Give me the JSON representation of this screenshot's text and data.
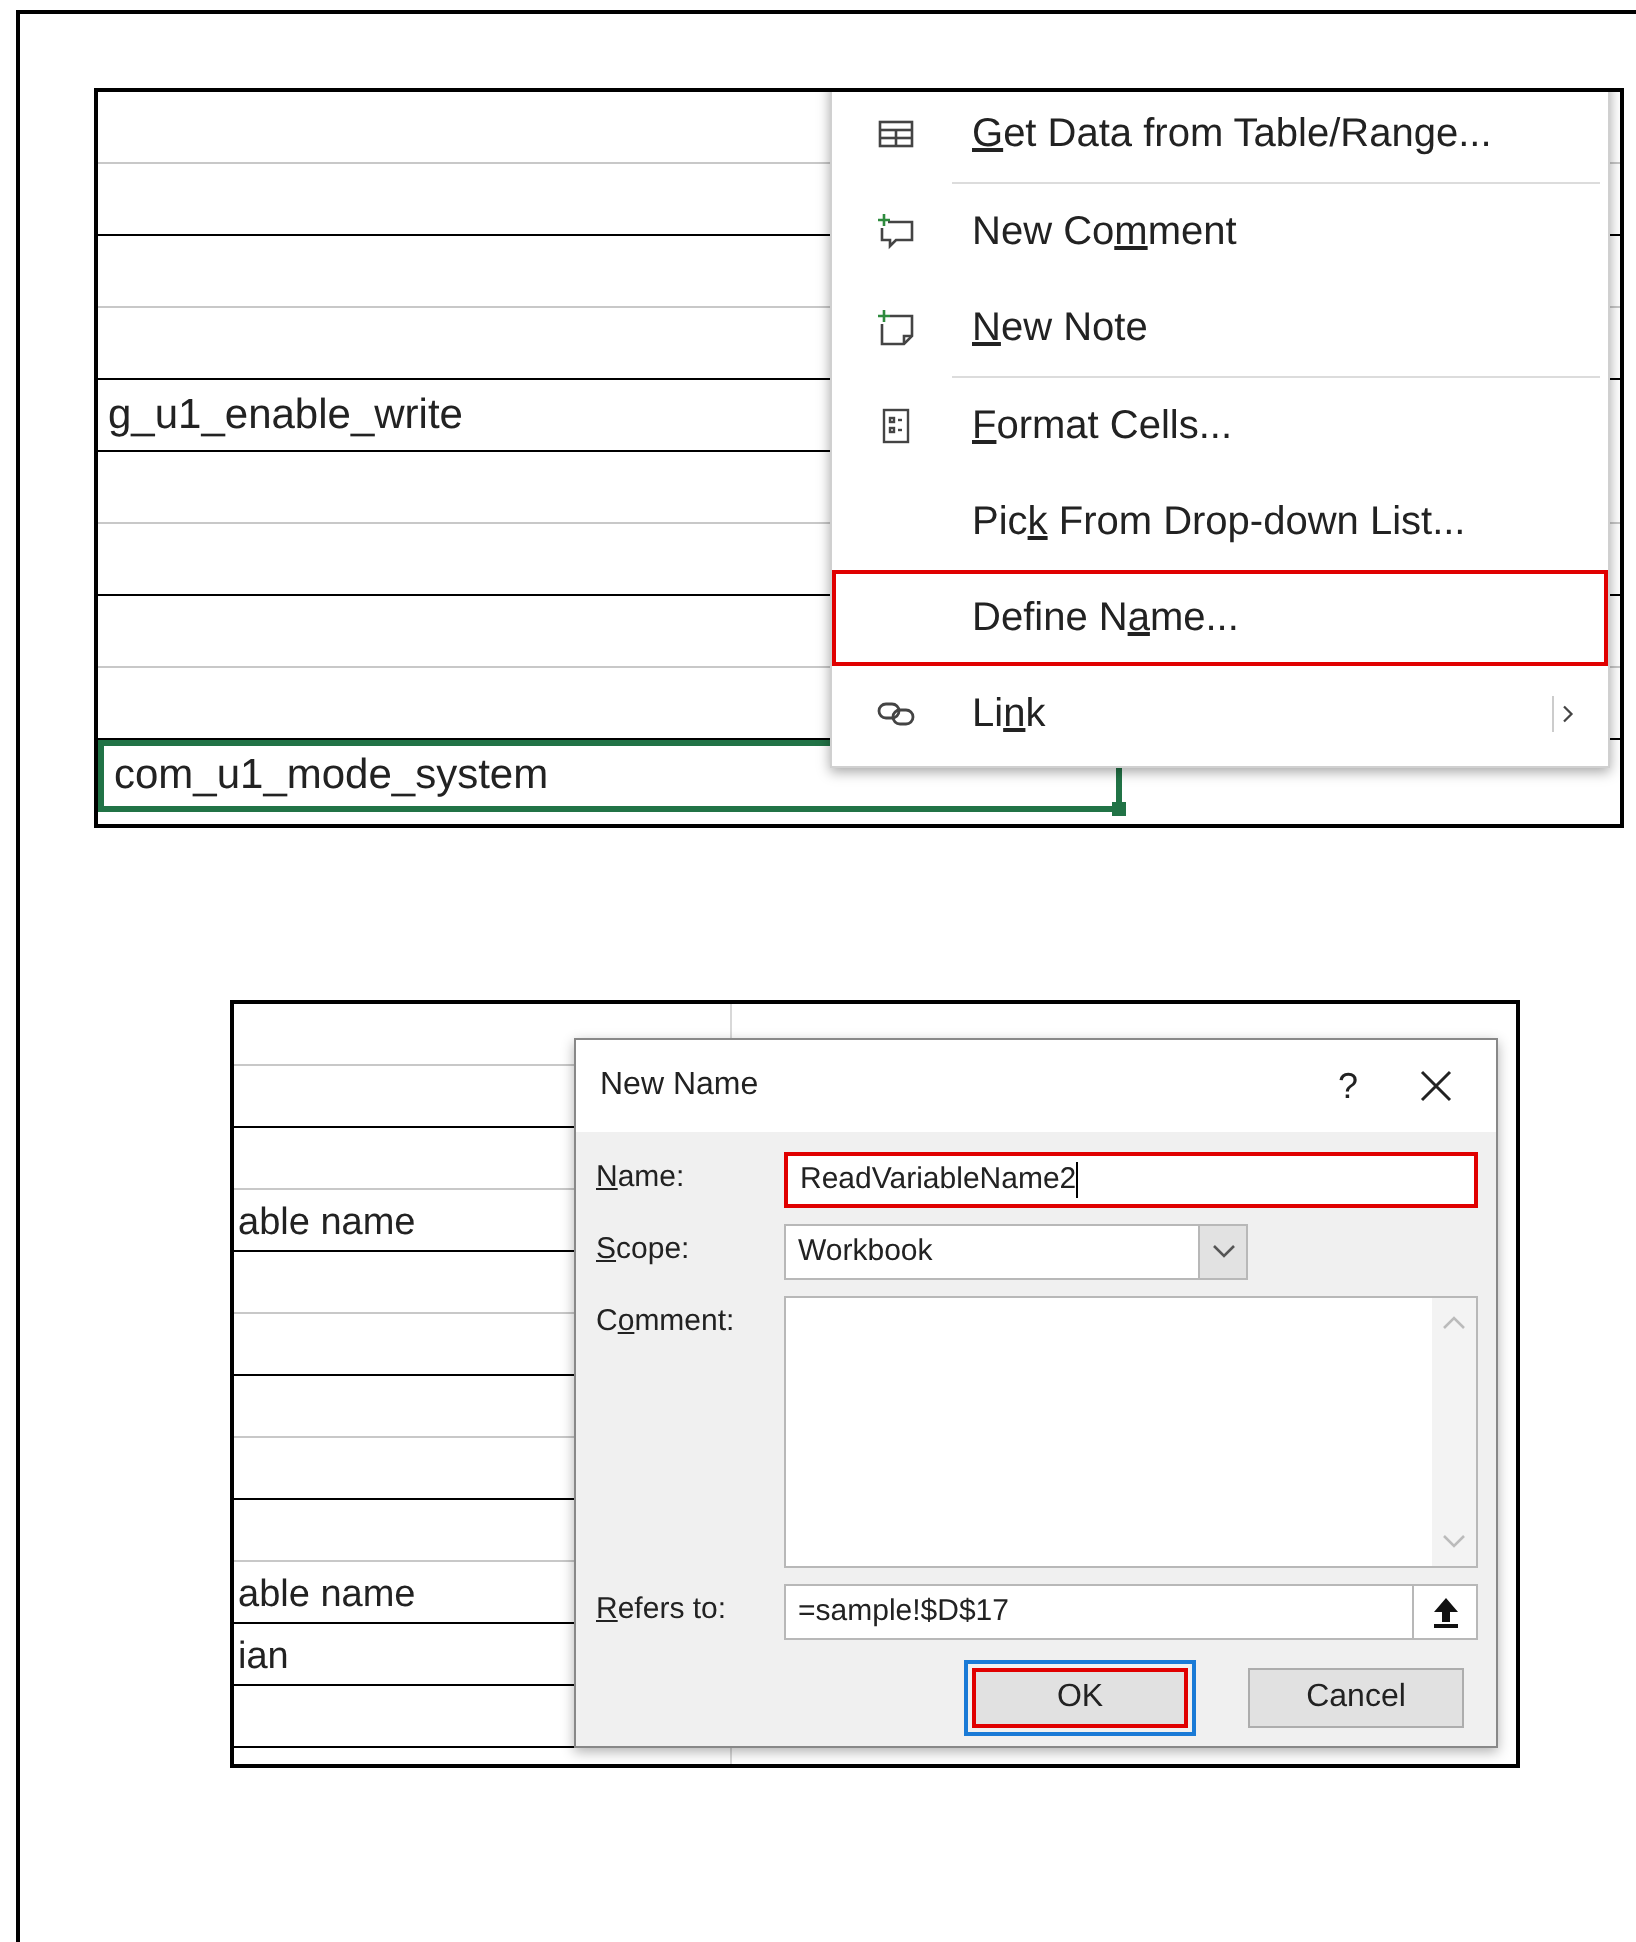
{
  "top_screenshot": {
    "sheet_rows": [
      {
        "column_1": "g_u1_enable_write",
        "selected": false
      },
      {
        "column_1": "com_u1_mode_system",
        "selected": true
      }
    ],
    "context_menu": {
      "items": [
        {
          "kind": "table",
          "label": {
            "key": "G",
            "after": "et Data from Table/Range..."
          },
          "highlighted": false
        },
        {
          "kind": "comment",
          "label": {
            "before": "New Co",
            "key": "m",
            "after": "ment"
          },
          "highlighted": false
        },
        {
          "kind": "note",
          "label": {
            "key": "N",
            "after": "ew Note"
          },
          "highlighted": false
        },
        {
          "kind": "format",
          "label": {
            "key": "F",
            "after": "ormat Cells..."
          },
          "highlighted": false
        },
        {
          "kind": "plain",
          "label": {
            "before": "Pic",
            "key": "k",
            "after": " From Drop-down List..."
          },
          "highlighted": false
        },
        {
          "kind": "plain",
          "label": {
            "before": "Define N",
            "key": "a",
            "after": "me..."
          },
          "highlighted": true
        },
        {
          "kind": "link",
          "label": {
            "before": "Li",
            "key": "n",
            "after": "k"
          },
          "highlighted": false
        }
      ]
    }
  },
  "bottom_screenshot": {
    "sheet_rows": [
      {
        "column_1": "able name"
      },
      {
        "column_1": "able name"
      },
      {
        "column_1": "ian"
      }
    ],
    "dialog": {
      "title": "New Name",
      "help": "?",
      "fields": [
        {
          "kind": "text",
          "label": {
            "key": "N",
            "after": "ame:"
          },
          "value": "ReadVariableName2",
          "highlighted": true
        },
        {
          "kind": "select",
          "label": {
            "key": "S",
            "after": "cope:"
          },
          "value": "Workbook",
          "highlighted": false
        },
        {
          "kind": "textarea",
          "label": {
            "before": "C",
            "key": "o",
            "after": "mment:"
          },
          "highlighted": false
        },
        {
          "kind": "reference",
          "label": {
            "key": "R",
            "after": "efers to:"
          },
          "value": "=sample!$D$17",
          "highlighted": false
        }
      ],
      "buttons": [
        {
          "label": "OK",
          "default": true,
          "highlighted": true
        },
        {
          "label": "Cancel",
          "default": false,
          "highlighted": false
        }
      ]
    }
  }
}
